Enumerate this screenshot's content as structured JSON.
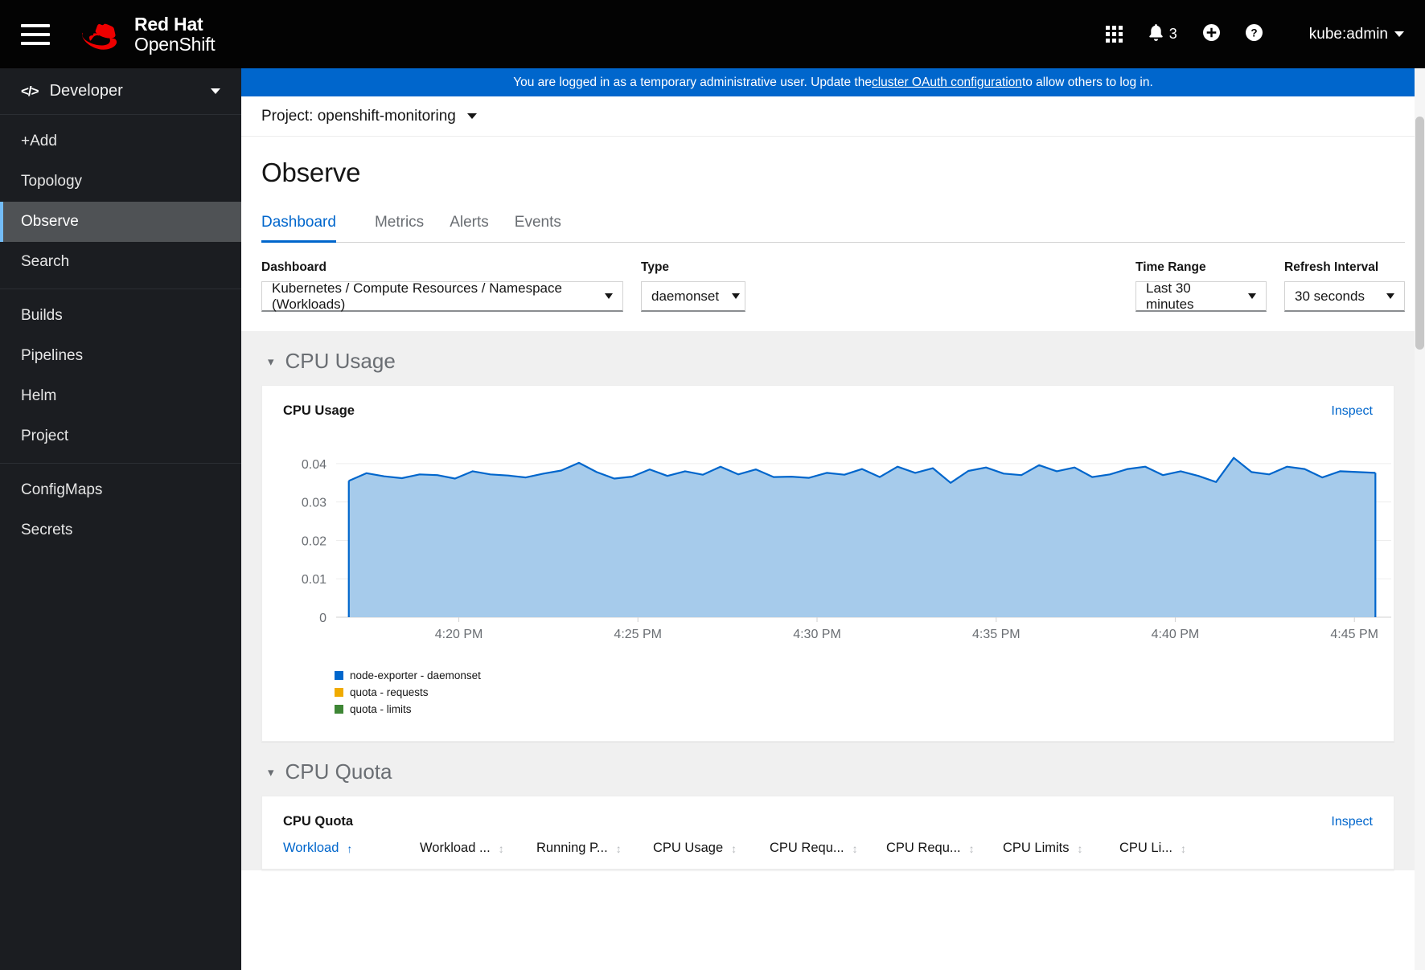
{
  "masthead": {
    "menu_icon": "hamburger-icon",
    "brand_line1": "Red Hat",
    "brand_line2": "OpenShift",
    "apps_icon": "grid-apps-icon",
    "notifications_icon": "bell-icon",
    "notification_count": "3",
    "add_icon": "plus-circle-icon",
    "help_icon": "question-circle-icon",
    "user": "kube:admin"
  },
  "sidebar": {
    "perspective": "Developer",
    "perspective_icon": "code-icon",
    "groups": [
      {
        "items": [
          {
            "label": "+Add",
            "active": false
          },
          {
            "label": "Topology",
            "active": false
          },
          {
            "label": "Observe",
            "active": true
          },
          {
            "label": "Search",
            "active": false
          }
        ]
      },
      {
        "items": [
          {
            "label": "Builds",
            "active": false
          },
          {
            "label": "Pipelines",
            "active": false
          },
          {
            "label": "Helm",
            "active": false
          },
          {
            "label": "Project",
            "active": false
          }
        ]
      },
      {
        "items": [
          {
            "label": "ConfigMaps",
            "active": false
          },
          {
            "label": "Secrets",
            "active": false
          }
        ]
      }
    ]
  },
  "notice": {
    "text_before": "You are logged in as a temporary administrative user. Update the ",
    "link": "cluster OAuth configuration",
    "text_after": " to allow others to log in."
  },
  "project_bar": {
    "label": "Project: openshift-monitoring"
  },
  "page": {
    "title": "Observe",
    "tabs": [
      {
        "label": "Dashboard",
        "active": true
      },
      {
        "label": "Metrics",
        "active": false
      },
      {
        "label": "Alerts",
        "active": false
      },
      {
        "label": "Events",
        "active": false
      }
    ]
  },
  "filters": {
    "dashboard": {
      "label": "Dashboard",
      "value": "Kubernetes / Compute Resources / Namespace (Workloads)"
    },
    "type": {
      "label": "Type",
      "value": "daemonset"
    },
    "time_range": {
      "label": "Time Range",
      "value": "Last 30 minutes"
    },
    "refresh_interval": {
      "label": "Refresh Interval",
      "value": "30 seconds"
    }
  },
  "sections": {
    "cpu_usage": {
      "section_title": "CPU Usage",
      "card_title": "CPU Usage",
      "inspect": "Inspect"
    },
    "cpu_quota": {
      "section_title": "CPU Quota",
      "card_title": "CPU Quota",
      "inspect": "Inspect",
      "columns": [
        {
          "label": "Workload",
          "sorted": true,
          "sort_icon": "sort-asc-icon"
        },
        {
          "label": "Workload ...",
          "sorted": false,
          "sort_icon": "sort-icon"
        },
        {
          "label": "Running P...",
          "sorted": false,
          "sort_icon": "sort-icon"
        },
        {
          "label": "CPU Usage",
          "sorted": false,
          "sort_icon": "sort-icon"
        },
        {
          "label": "CPU Requ...",
          "sorted": false,
          "sort_icon": "sort-icon"
        },
        {
          "label": "CPU Requ...",
          "sorted": false,
          "sort_icon": "sort-icon"
        },
        {
          "label": "CPU Limits",
          "sorted": false,
          "sort_icon": "sort-icon"
        },
        {
          "label": "CPU Li...",
          "sorted": false,
          "sort_icon": "sort-icon"
        }
      ]
    }
  },
  "chart_data": {
    "type": "area",
    "title": "CPU Usage",
    "xlabel": "",
    "ylabel": "",
    "ylim": [
      0,
      0.045
    ],
    "yticks": [
      0,
      0.01,
      0.02,
      0.03,
      0.04
    ],
    "ytick_labels": [
      "0",
      "0.01",
      "0.02",
      "0.03",
      "0.04"
    ],
    "xtick_labels": [
      "4:20 PM",
      "4:25 PM",
      "4:30 PM",
      "4:35 PM",
      "4:40 PM",
      "4:45 PM"
    ],
    "xtick_positions": [
      0.1163,
      0.286,
      0.4558,
      0.6256,
      0.7953,
      0.9651
    ],
    "grid": true,
    "legend_position": "bottom-left",
    "series": [
      {
        "name": "node-exporter - daemonset",
        "color": "#0066cc",
        "fill": "#a6cbeb",
        "values": [
          0.0355,
          0.0375,
          0.0367,
          0.0362,
          0.0372,
          0.037,
          0.0361,
          0.038,
          0.0372,
          0.0369,
          0.0364,
          0.0374,
          0.0382,
          0.0402,
          0.0378,
          0.0361,
          0.0366,
          0.0385,
          0.0368,
          0.038,
          0.0371,
          0.0392,
          0.0372,
          0.0385,
          0.0365,
          0.0366,
          0.0363,
          0.0376,
          0.0371,
          0.0386,
          0.0365,
          0.0392,
          0.0376,
          0.0388,
          0.035,
          0.0381,
          0.039,
          0.0374,
          0.037,
          0.0396,
          0.038,
          0.039,
          0.0365,
          0.0372,
          0.0386,
          0.0392,
          0.037,
          0.038,
          0.0368,
          0.0352,
          0.0415,
          0.0378,
          0.0372,
          0.0392,
          0.0386,
          0.0364,
          0.038,
          0.0378,
          0.0376
        ]
      },
      {
        "name": "quota - requests",
        "color": "#f0ab00",
        "fill": "#f0ab00",
        "values": []
      },
      {
        "name": "quota - limits",
        "color": "#3e8635",
        "fill": "#3e8635",
        "values": []
      }
    ]
  }
}
